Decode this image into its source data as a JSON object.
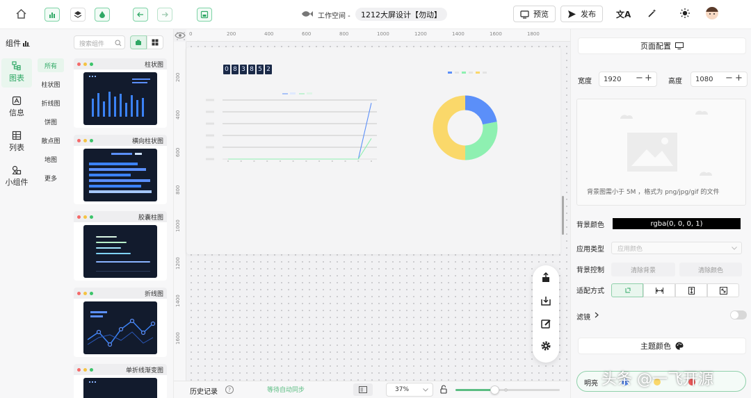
{
  "topbar": {
    "workspace_label": "工作空间 -",
    "project_name": "1212大屏设计【勿动】",
    "preview_label": "预览",
    "publish_label": "发布"
  },
  "left": {
    "header_label": "组件",
    "search_placeholder": "搜索组件",
    "nav": [
      {
        "label": "图表",
        "icon": "chart-tree-icon"
      },
      {
        "label": "信息",
        "icon": "info-text-icon"
      },
      {
        "label": "列表",
        "icon": "table-icon"
      },
      {
        "label": "小组件",
        "icon": "widget-icon"
      }
    ],
    "categories": [
      "所有",
      "柱状图",
      "折线图",
      "饼图",
      "散点图",
      "地图",
      "更多"
    ],
    "cards": [
      {
        "title": "柱状图"
      },
      {
        "title": "横向柱状图"
      },
      {
        "title": "胶囊柱图"
      },
      {
        "title": "折线图"
      },
      {
        "title": "单折线渐变图"
      }
    ]
  },
  "canvas": {
    "ruler_top": [
      "0",
      "200",
      "400",
      "600",
      "800",
      "1000",
      "1200",
      "1400",
      "1600",
      "1800"
    ],
    "ruler_left": [
      "200",
      "400",
      "600",
      "800",
      "1000",
      "1200",
      "1400",
      "1600"
    ],
    "counter_digits": [
      "0",
      "8",
      "3",
      "8",
      "5",
      "2"
    ]
  },
  "bottombar": {
    "history_label": "历史记录",
    "sync_label": "等待自动同步",
    "zoom_value": "37%",
    "zoom_fraction": 0.37
  },
  "right": {
    "page_config_label": "页面配置",
    "width_label": "宽度",
    "width_value": "1920",
    "height_label": "高度",
    "height_value": "1080",
    "bg_hint": "背景图需小于 5M ，格式为 png/jpg/gif 的文件",
    "bg_color_label": "背景颜色",
    "bg_color_value": "rgba(0, 0, 0, 1)",
    "apply_type_label": "应用类型",
    "apply_type_placeholder": "应用颜色",
    "bg_control_label": "背景控制",
    "clear_bg_label": "清除背景",
    "clear_color_label": "清除颜色",
    "fit_label": "适配方式",
    "filter_label": "滤镜",
    "theme_color_label": "主题颜色",
    "theme_mode_label": "明亮",
    "watermark_text": "头条 @一飞开源"
  },
  "colors": {
    "accent": "#2fa865",
    "blue": "#5b8ff9",
    "green": "#8ef0b1",
    "yellow": "#fad86a"
  },
  "chart_data": [
    {
      "type": "line",
      "series": [
        {
          "values": [
            0,
            0,
            0,
            0,
            0,
            0,
            0,
            0,
            0,
            0,
            0,
            95
          ]
        },
        {
          "values": [
            0,
            0,
            0,
            0,
            0,
            0,
            0,
            0,
            0,
            0,
            0,
            35
          ]
        }
      ]
    },
    {
      "type": "pie",
      "values": [
        22,
        28,
        50
      ],
      "colors": [
        "#5b8ff9",
        "#8ef0b1",
        "#fad86a"
      ]
    }
  ]
}
